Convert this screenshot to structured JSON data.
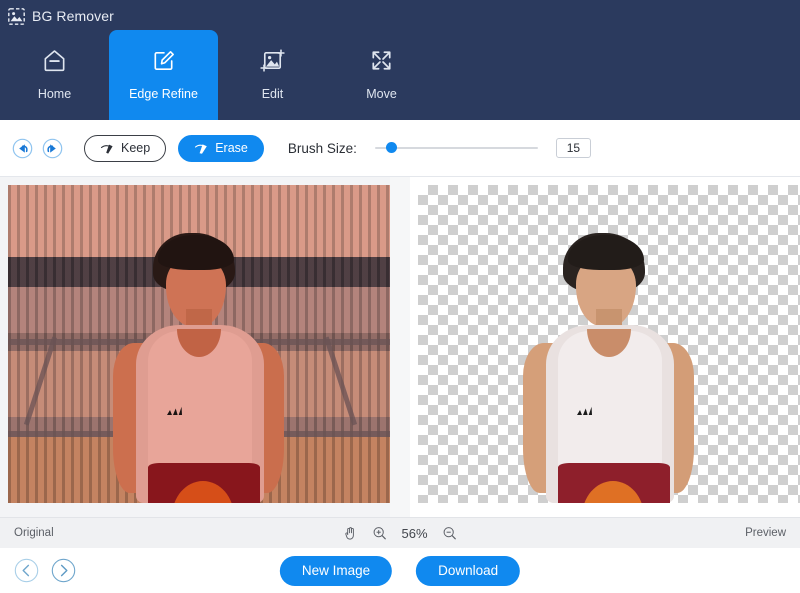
{
  "app": {
    "title": "BG Remover",
    "logo_icon": "image-placeholder-icon",
    "header_bg": "#2b3a5e",
    "accent": "#1089ef"
  },
  "nav": {
    "items": [
      {
        "label": "Home",
        "icon": "home-icon",
        "active": false
      },
      {
        "label": "Edge Refine",
        "icon": "edit-pen-square-icon",
        "active": true
      },
      {
        "label": "Edit",
        "icon": "image-crop-icon",
        "active": false
      },
      {
        "label": "Move",
        "icon": "move-arrows-icon",
        "active": false
      }
    ]
  },
  "toolbar": {
    "undo_icon": "undo-circle-icon",
    "redo_icon": "redo-circle-icon",
    "keep_label": "Keep",
    "keep_icon": "brush-keep-icon",
    "erase_label": "Erase",
    "erase_icon": "brush-erase-icon",
    "active_mode": "Erase",
    "brush_size_label": "Brush Size:",
    "brush_size_value": "15",
    "slider_percent": 10
  },
  "canvas": {
    "left_pane_label": "Original",
    "right_pane_label": "Preview",
    "left_overlay": "red selection tint",
    "right_background": "transparency checkerboard"
  },
  "statusbar": {
    "left_label": "Original",
    "right_label": "Preview",
    "hand_icon": "hand-pan-icon",
    "zoom_in_icon": "zoom-in-icon",
    "zoom_out_icon": "zoom-out-icon",
    "zoom_level": "56%"
  },
  "footer": {
    "prev_icon": "chevron-left-circle-icon",
    "next_icon": "chevron-right-circle-icon",
    "new_image_label": "New Image",
    "download_label": "Download"
  }
}
